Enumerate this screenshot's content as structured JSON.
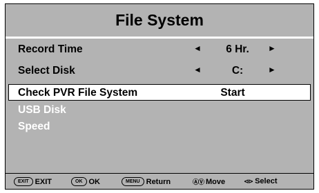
{
  "window": {
    "title": "File System"
  },
  "menu": {
    "record_time": {
      "label": "Record Time",
      "value": "6 Hr.",
      "left_arrow": "◄",
      "right_arrow": "►"
    },
    "select_disk": {
      "label": "Select Disk",
      "value": "C:",
      "left_arrow": "◄",
      "right_arrow": "►"
    },
    "check_pvr": {
      "label": "Check PVR File System",
      "value": "Start"
    }
  },
  "info": {
    "usb_disk": "USB Disk",
    "speed": "Speed"
  },
  "footer": {
    "exit": {
      "key": "EXIT",
      "label": "EXIT"
    },
    "ok": {
      "key": "OK",
      "label": "OK"
    },
    "menu": {
      "key": "MENU",
      "label": "Return"
    },
    "move": {
      "glyph": "ⒶⓋ",
      "label": "Move"
    },
    "select": {
      "glyph": "⊲⊳",
      "label": "Select"
    }
  },
  "colors": {
    "panel": "#b3b3b3",
    "highlight": "#ffffff",
    "text": "#000000",
    "info_text": "#ffffff"
  }
}
